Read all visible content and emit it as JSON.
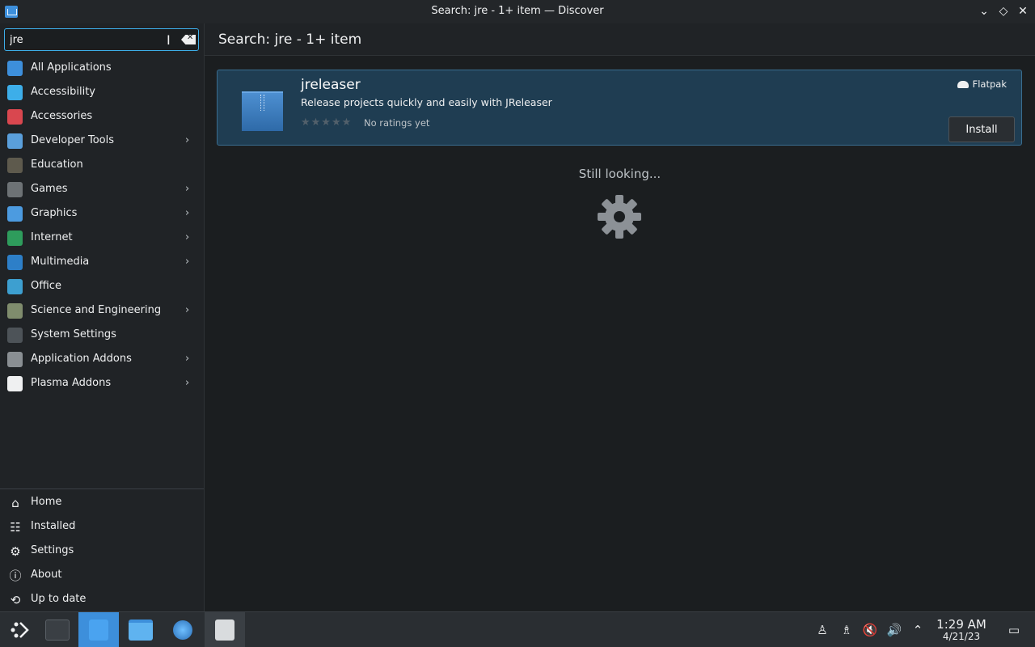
{
  "window": {
    "title": "Search: jre - 1+ item — Discover"
  },
  "search": {
    "value": "jre",
    "placeholder": ""
  },
  "sidebar": {
    "categories": [
      {
        "label": "All Applications",
        "icon": "grid-icon",
        "color": "#3d8fdb",
        "has_submenu": false
      },
      {
        "label": "Accessibility",
        "icon": "accessibility-icon",
        "color": "#3daee9",
        "has_submenu": false
      },
      {
        "label": "Accessories",
        "icon": "toolbox-icon",
        "color": "#d9474f",
        "has_submenu": false
      },
      {
        "label": "Developer Tools",
        "icon": "wrench-icon",
        "color": "#5a9fdb",
        "has_submenu": true
      },
      {
        "label": "Education",
        "icon": "chalkboard-icon",
        "color": "#5e5a4d",
        "has_submenu": false
      },
      {
        "label": "Games",
        "icon": "gamepad-icon",
        "color": "#6d7275",
        "has_submenu": true
      },
      {
        "label": "Graphics",
        "icon": "graphics-icon",
        "color": "#4c9be0",
        "has_submenu": true
      },
      {
        "label": "Internet",
        "icon": "globe-icon",
        "color": "#2e9c5c",
        "has_submenu": true
      },
      {
        "label": "Multimedia",
        "icon": "monitor-icon",
        "color": "#2d7fc8",
        "has_submenu": true
      },
      {
        "label": "Office",
        "icon": "office-icon",
        "color": "#3d9fd0",
        "has_submenu": false
      },
      {
        "label": "Science and Engineering",
        "icon": "flask-icon",
        "color": "#7f8c6d",
        "has_submenu": true
      },
      {
        "label": "System Settings",
        "icon": "settings-icon",
        "color": "#4d5358",
        "has_submenu": false
      },
      {
        "label": "Application Addons",
        "icon": "addons-icon",
        "color": "#8a8f93",
        "has_submenu": true
      },
      {
        "label": "Plasma Addons",
        "icon": "plasma-icon",
        "color": "#eff0f1",
        "has_submenu": true
      }
    ],
    "nav": [
      {
        "label": "Home",
        "icon": "home-icon",
        "glyph": "⌂"
      },
      {
        "label": "Installed",
        "icon": "installed-list-icon",
        "glyph": "☷"
      },
      {
        "label": "Settings",
        "icon": "settings-sliders-icon",
        "glyph": "⚙"
      },
      {
        "label": "About",
        "icon": "info-icon",
        "glyph": "ⓘ"
      },
      {
        "label": "Up to date",
        "icon": "update-icon",
        "glyph": "⟲"
      }
    ]
  },
  "main": {
    "title": "Search: jre - 1+ item",
    "results": [
      {
        "name": "jreleaser",
        "description": "Release projects quickly and easily with JReleaser",
        "stars": "★★★★★",
        "rating_text": "No ratings yet",
        "source": "Flatpak",
        "install_label": "Install"
      }
    ],
    "status_text": "Still looking..."
  },
  "taskbar": {
    "clock": {
      "time": "1:29 AM",
      "date": "4/21/23"
    }
  },
  "colors": {
    "accent": "#3daee9",
    "card_bg": "#1f3d52",
    "taskbar_active": "#3d8fdb"
  }
}
